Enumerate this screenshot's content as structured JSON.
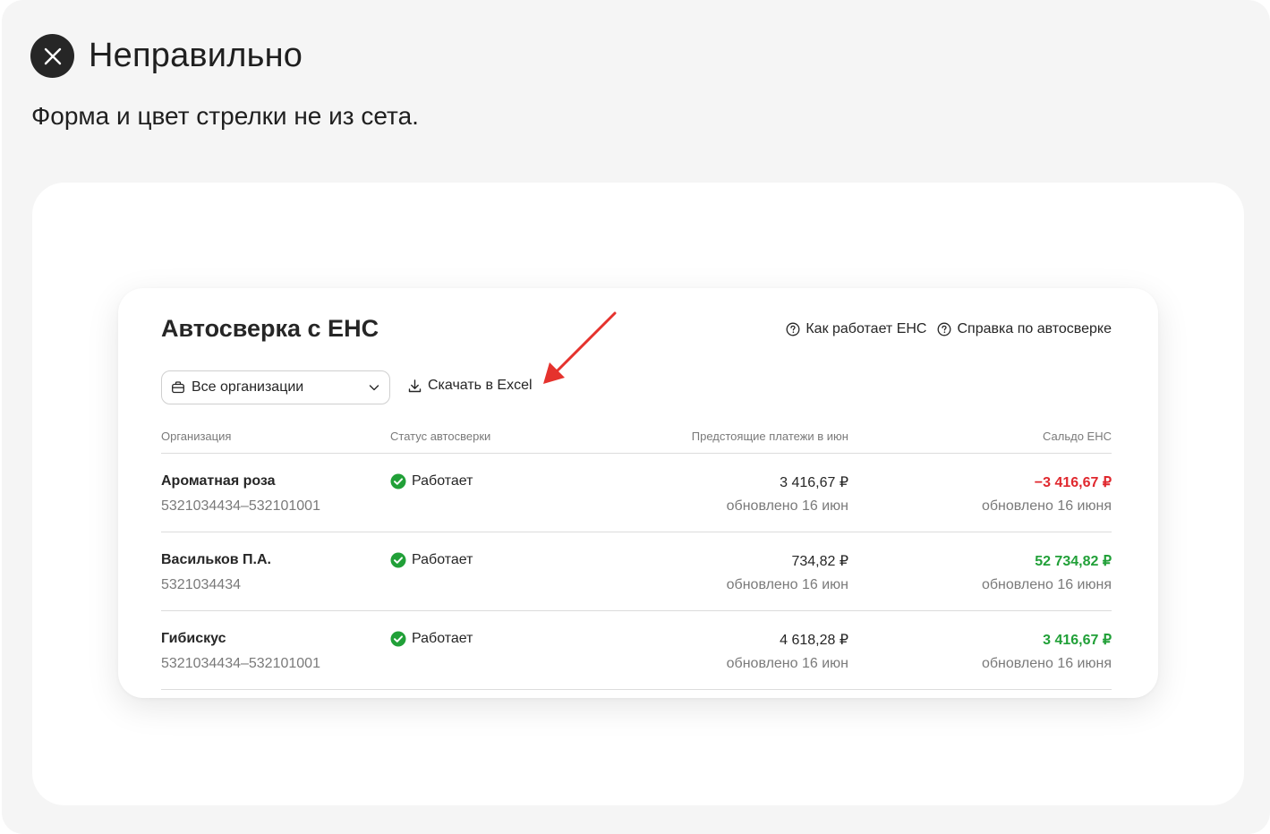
{
  "verdict": {
    "title": "Неправильно",
    "description": "Форма и цвет стрелки не из сета."
  },
  "card": {
    "title": "Автосверка с ЕНС",
    "help_links": [
      {
        "label": "Как работает ЕНС",
        "icon": "question-circle-icon"
      },
      {
        "label": "Справка по автосверке",
        "icon": "question-circle-icon"
      }
    ],
    "org_select": {
      "value": "Все организации",
      "icon": "briefcase-icon"
    },
    "download": {
      "label": "Скачать в Excel",
      "icon": "download-icon"
    },
    "columns": {
      "organization": "Организация",
      "status": "Статус автосверки",
      "payments": "Предстоящие платежи в июн",
      "saldo": "Сальдо ЕНС"
    },
    "rows": [
      {
        "name": "Ароматная роза",
        "inn": "5321034434–532101001",
        "status": "Работает",
        "amount": "3 416,67 ₽",
        "amount_date": "обновлено 16 июн",
        "saldo": "−3 416,67 ₽",
        "saldo_sign": "negative",
        "saldo_date": "обновлено 16 июня"
      },
      {
        "name": "Васильков П.А.",
        "inn": "5321034434",
        "status": "Работает",
        "amount": "734,82 ₽",
        "amount_date": "обновлено 16 июн",
        "saldo": "52 734,82 ₽",
        "saldo_sign": "positive",
        "saldo_date": "обновлено 16 июня"
      },
      {
        "name": "Гибискус",
        "inn": "5321034434–532101001",
        "status": "Работает",
        "amount": "4 618,28 ₽",
        "amount_date": "обновлено 16 июн",
        "saldo": "3 416,67 ₽",
        "saldo_sign": "positive",
        "saldo_date": "обновлено 16 июня"
      }
    ]
  },
  "colors": {
    "negative": "#e0282e",
    "positive": "#21a038",
    "status_ok": "#21a038",
    "annotation_arrow": "#e5322d"
  }
}
